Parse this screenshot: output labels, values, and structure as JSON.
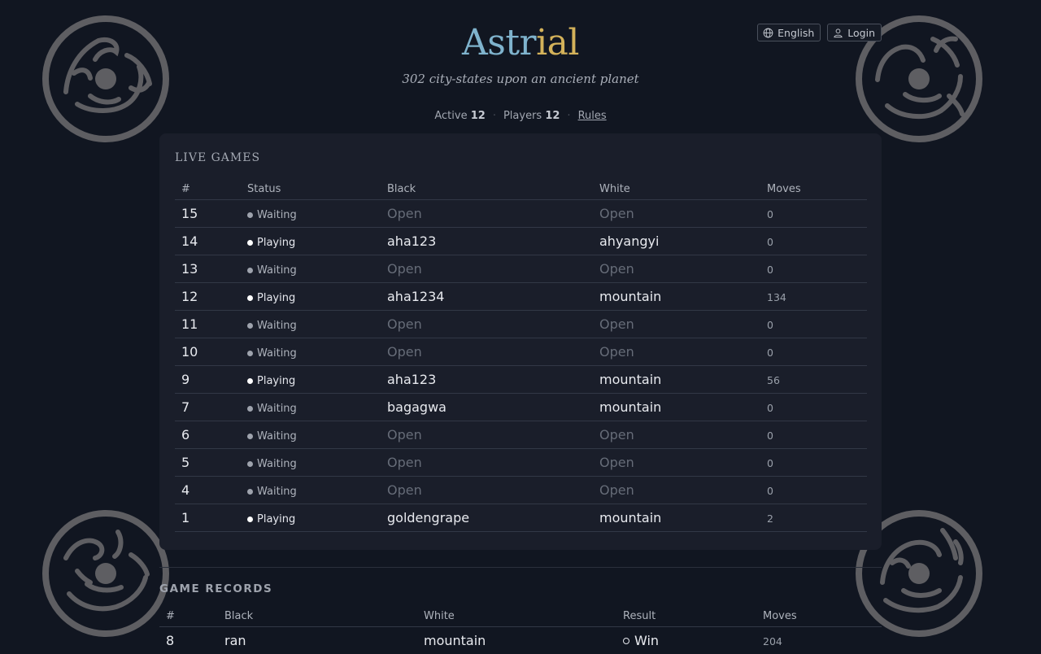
{
  "header": {
    "title_part1": "Astr",
    "title_part2": "ial",
    "subtitle": "302 city-states upon an ancient planet",
    "title_colors": {
      "part1": "#7fb3cd",
      "part2": "#d4b25a"
    }
  },
  "top_buttons": {
    "language": {
      "label": "English",
      "icon": "globe-icon"
    },
    "login": {
      "label": "Login",
      "icon": "user-icon"
    }
  },
  "stats": {
    "active_label": "Active",
    "active_value": "12",
    "players_label": "Players",
    "players_value": "12",
    "rules_label": "Rules"
  },
  "live_games": {
    "title": "LIVE GAMES",
    "columns": [
      "#",
      "Status",
      "Black",
      "White",
      "Moves"
    ],
    "rows": [
      {
        "id": "15",
        "status": "Waiting",
        "black": "Open",
        "white": "Open",
        "moves": "0"
      },
      {
        "id": "14",
        "status": "Playing",
        "black": "aha123",
        "white": "ahyangyi",
        "moves": "0"
      },
      {
        "id": "13",
        "status": "Waiting",
        "black": "Open",
        "white": "Open",
        "moves": "0"
      },
      {
        "id": "12",
        "status": "Playing",
        "black": "aha1234",
        "white": "mountain",
        "moves": "134"
      },
      {
        "id": "11",
        "status": "Waiting",
        "black": "Open",
        "white": "Open",
        "moves": "0"
      },
      {
        "id": "10",
        "status": "Waiting",
        "black": "Open",
        "white": "Open",
        "moves": "0"
      },
      {
        "id": "9",
        "status": "Playing",
        "black": "aha123",
        "white": "mountain",
        "moves": "56"
      },
      {
        "id": "7",
        "status": "Waiting",
        "black": "bagagwa",
        "white": "mountain",
        "moves": "0"
      },
      {
        "id": "6",
        "status": "Waiting",
        "black": "Open",
        "white": "Open",
        "moves": "0"
      },
      {
        "id": "5",
        "status": "Waiting",
        "black": "Open",
        "white": "Open",
        "moves": "0"
      },
      {
        "id": "4",
        "status": "Waiting",
        "black": "Open",
        "white": "Open",
        "moves": "0"
      },
      {
        "id": "1",
        "status": "Playing",
        "black": "goldengrape",
        "white": "mountain",
        "moves": "2"
      }
    ]
  },
  "game_records": {
    "title": "GAME RECORDS",
    "columns": [
      "#",
      "Black",
      "White",
      "Result",
      "Moves"
    ],
    "rows": [
      {
        "id": "8",
        "black": "ran",
        "white": "mountain",
        "result": "Win",
        "result_icon": "white-stone-icon",
        "moves": "204"
      }
    ]
  },
  "status_colors": {
    "Playing": "#ffffff",
    "Waiting": "#9ea3ad"
  },
  "emblems": [
    "tiger-emblem-icon",
    "dragon-emblem-icon",
    "tiger-emblem-icon",
    "phoenix-emblem-icon"
  ]
}
